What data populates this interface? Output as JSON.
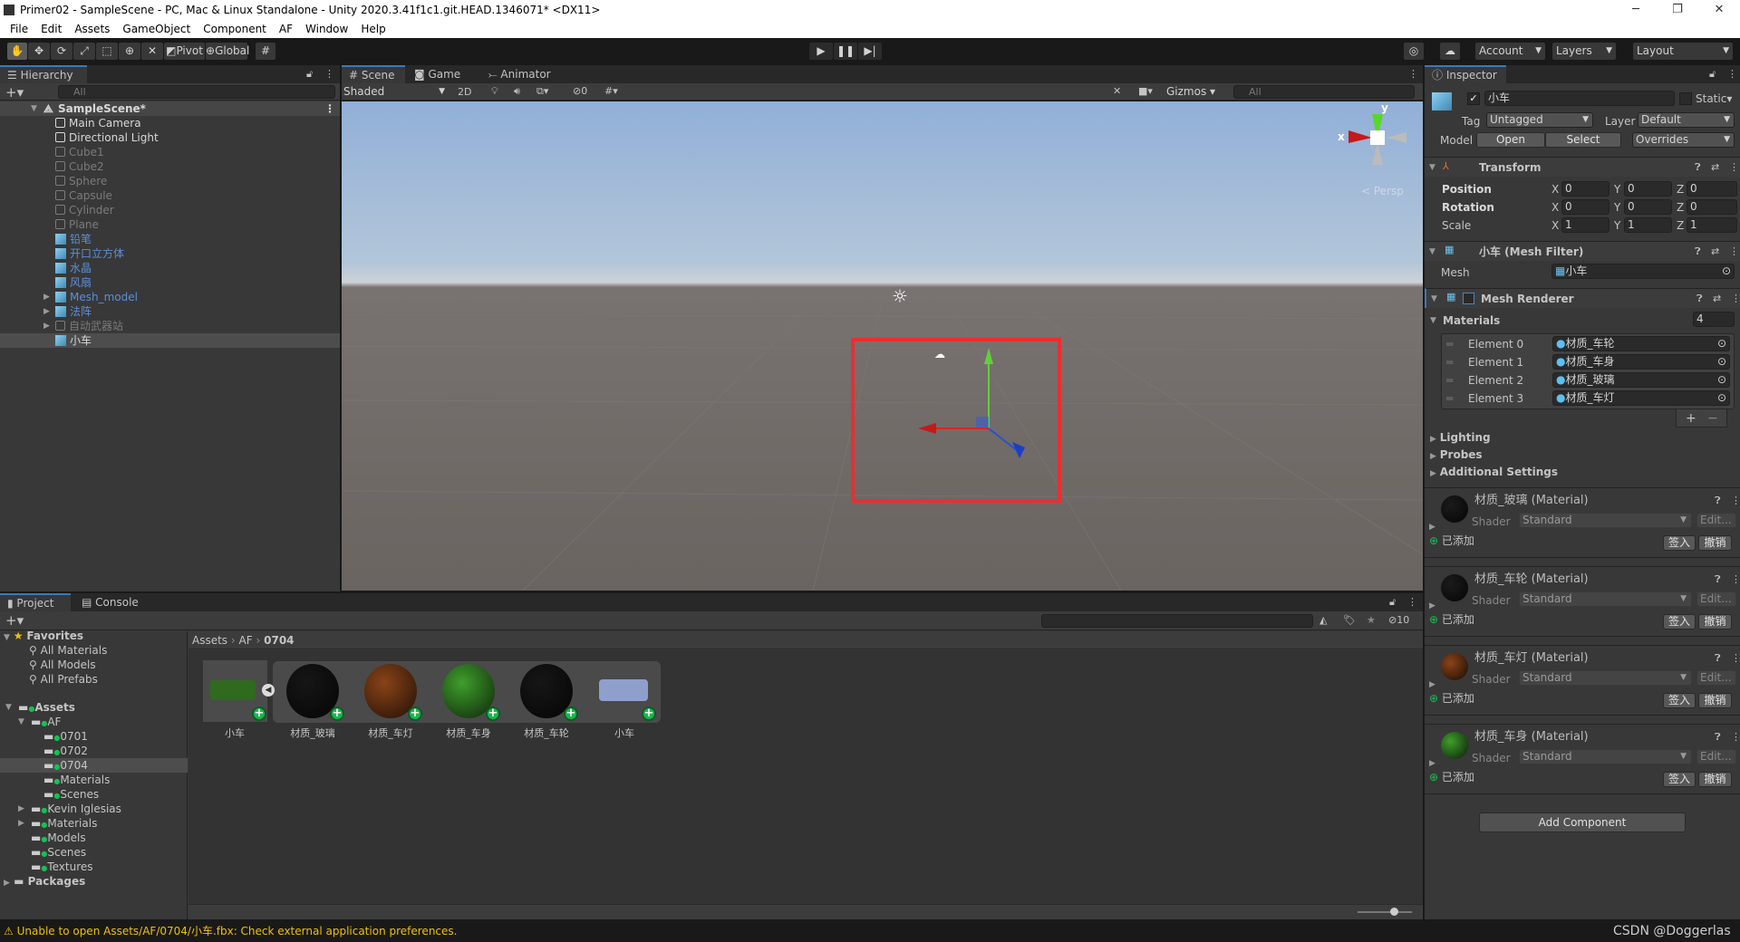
{
  "window": {
    "title": "Primer02 - SampleScene - PC, Mac & Linux Standalone - Unity 2020.3.41f1c1.git.HEAD.1346071* <DX11>",
    "minimize": "─",
    "maximize": "❐",
    "close": "✕"
  },
  "menu": [
    "File",
    "Edit",
    "Assets",
    "GameObject",
    "Component",
    "AF",
    "Window",
    "Help"
  ],
  "toolbar": {
    "pivot": "Pivot",
    "global": "Global",
    "account": "Account",
    "layers": "Layers",
    "layout": "Layout"
  },
  "hierarchy": {
    "tab": "Hierarchy",
    "search_placeholder": "All",
    "scene": "SampleScene*",
    "items": [
      {
        "label": "Main Camera",
        "state": "active"
      },
      {
        "label": "Directional Light",
        "state": "active"
      },
      {
        "label": "Cube1",
        "state": "inactive"
      },
      {
        "label": "Cube2",
        "state": "inactive"
      },
      {
        "label": "Sphere",
        "state": "inactive"
      },
      {
        "label": "Capsule",
        "state": "inactive"
      },
      {
        "label": "Cylinder",
        "state": "inactive"
      },
      {
        "label": "Plane",
        "state": "inactive"
      },
      {
        "label": "铅笔",
        "state": "prefab"
      },
      {
        "label": "开口立方体",
        "state": "prefab"
      },
      {
        "label": "水晶",
        "state": "prefab"
      },
      {
        "label": "风扇",
        "state": "prefab"
      },
      {
        "label": "Mesh_model",
        "state": "prefab",
        "expandable": true
      },
      {
        "label": "法阵",
        "state": "prefab",
        "expandable": true
      },
      {
        "label": "自动武器站",
        "state": "inactive",
        "expandable": true
      },
      {
        "label": "小车",
        "state": "selected"
      }
    ]
  },
  "scene": {
    "tabs": [
      "Scene",
      "Game",
      "Animator"
    ],
    "shading": "Shaded",
    "mode_2d": "2D",
    "hidden_count": "0",
    "gizmos": "Gizmos",
    "search_placeholder": "All",
    "persp": "Persp",
    "axis_x": "x",
    "axis_y": "y"
  },
  "inspector": {
    "tab": "Inspector",
    "name": "小车",
    "active": true,
    "static": "Static",
    "tag_label": "Tag",
    "tag": "Untagged",
    "layer_label": "Layer",
    "layer": "Default",
    "model_label": "Model",
    "open": "Open",
    "select": "Select",
    "overrides": "Overrides",
    "transform": {
      "title": "Transform",
      "rows": [
        {
          "label": "Position",
          "x": "0",
          "y": "0",
          "z": "0"
        },
        {
          "label": "Rotation",
          "x": "0",
          "y": "0",
          "z": "0"
        },
        {
          "label": "Scale",
          "x": "1",
          "y": "1",
          "z": "1"
        }
      ]
    },
    "mesh_filter": {
      "title": "小车 (Mesh Filter)",
      "mesh_label": "Mesh",
      "mesh": "小车"
    },
    "mesh_renderer": {
      "title": "Mesh Renderer",
      "materials_label": "Materials",
      "count": "4",
      "elements": [
        {
          "label": "Element 0",
          "value": "材质_车轮"
        },
        {
          "label": "Element 1",
          "value": "材质_车身"
        },
        {
          "label": "Element 2",
          "value": "材质_玻璃"
        },
        {
          "label": "Element 3",
          "value": "材质_车灯"
        }
      ],
      "sections": [
        "Lighting",
        "Probes",
        "Additional Settings"
      ]
    },
    "materials": [
      {
        "title": "材质_玻璃 (Material)",
        "color": "#1b1b1b"
      },
      {
        "title": "材质_车轮 (Material)",
        "color": "#1b1b1b"
      },
      {
        "title": "材质_车灯 (Material)",
        "color": "#8a4318"
      },
      {
        "title": "材质_车身 (Material)",
        "color": "#3f9e2c"
      }
    ],
    "shader_label": "Shader",
    "shader": "Standard",
    "edit": "Edit...",
    "added": "已添加",
    "checkin": "签入",
    "revert": "撤销",
    "add_component": "Add Component"
  },
  "project": {
    "tabs": [
      "Project",
      "Console"
    ],
    "hidden_count": "10",
    "favorites": {
      "label": "Favorites",
      "items": [
        "All Materials",
        "All Models",
        "All Prefabs"
      ]
    },
    "tree": [
      {
        "label": "Assets",
        "depth": 0,
        "bold": true
      },
      {
        "label": "AF",
        "depth": 1
      },
      {
        "label": "0701",
        "depth": 2
      },
      {
        "label": "0702",
        "depth": 2
      },
      {
        "label": "0704",
        "depth": 2,
        "selected": true
      },
      {
        "label": "Materials",
        "depth": 2
      },
      {
        "label": "Scenes",
        "depth": 2
      },
      {
        "label": "Kevin Iglesias",
        "depth": 1,
        "expandable": true
      },
      {
        "label": "Materials",
        "depth": 1,
        "expandable": true
      },
      {
        "label": "Models",
        "depth": 1
      },
      {
        "label": "Scenes",
        "depth": 1
      },
      {
        "label": "Textures",
        "depth": 1
      }
    ],
    "packages": "Packages",
    "breadcrumb": [
      "Assets",
      "AF",
      "0704"
    ],
    "assets": [
      {
        "label": "小车",
        "kind": "model"
      },
      {
        "label": "材质_玻璃",
        "kind": "material",
        "color": "#161616"
      },
      {
        "label": "材质_车灯",
        "kind": "material",
        "color": "#8a4318"
      },
      {
        "label": "材质_车身",
        "kind": "material",
        "color": "#3f9e2c"
      },
      {
        "label": "材质_车轮",
        "kind": "material",
        "color": "#161616"
      },
      {
        "label": "小车",
        "kind": "mesh"
      }
    ]
  },
  "status": {
    "message": "Unable to open Assets/AF/0704/小车.fbx: Check external application preferences.",
    "watermark": "CSDN @Doggerlas"
  }
}
